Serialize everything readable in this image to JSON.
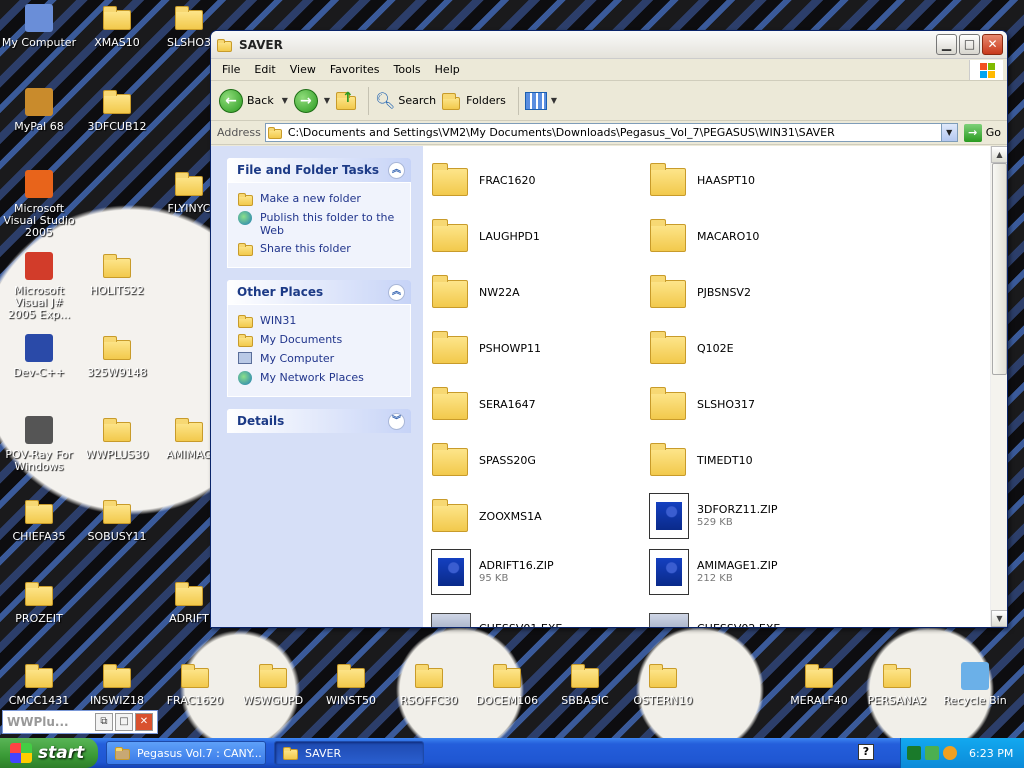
{
  "desktop": {
    "icons": [
      {
        "label": "My Computer",
        "kind": "system",
        "color": "#6a8ed8"
      },
      {
        "label": "XMAS10",
        "kind": "folder"
      },
      {
        "label": "SLSHO3",
        "kind": "folder"
      },
      {
        "label": "MyPal 68",
        "kind": "system",
        "color": "#c98b2c"
      },
      {
        "label": "3DFCUB12",
        "kind": "folder"
      },
      {
        "label": "Microsoft Visual Studio 2005",
        "kind": "system",
        "color": "#e8641b"
      },
      {
        "label": "FLYINYC",
        "kind": "folder"
      },
      {
        "label": "Microsoft Visual J# 2005 Exp...",
        "kind": "system",
        "color": "#d23c2a"
      },
      {
        "label": "HOLITS22",
        "kind": "folder"
      },
      {
        "label": "Dev-C++",
        "kind": "system",
        "color": "#2a4aa8"
      },
      {
        "label": "325W9148",
        "kind": "folder"
      },
      {
        "label": "POV-Ray For Windows",
        "kind": "system",
        "color": "#555555"
      },
      {
        "label": "WWPLUS30",
        "kind": "folder"
      },
      {
        "label": "AMIMAG",
        "kind": "folder"
      },
      {
        "label": "CHIEFA35",
        "kind": "folder"
      },
      {
        "label": "SOBUSY11",
        "kind": "folder"
      },
      {
        "label": "PROZEIT",
        "kind": "folder"
      },
      {
        "label": "ADRIFT",
        "kind": "folder"
      },
      {
        "label": "CMCC1431",
        "kind": "folder"
      },
      {
        "label": "INSWIZ18",
        "kind": "folder"
      },
      {
        "label": "FRAC1620",
        "kind": "folder"
      },
      {
        "label": "WSWGUPD",
        "kind": "folder"
      },
      {
        "label": "WINST50",
        "kind": "folder"
      },
      {
        "label": "RSOFFC30",
        "kind": "folder"
      },
      {
        "label": "DOCEM106",
        "kind": "folder"
      },
      {
        "label": "SBBASIC",
        "kind": "folder"
      },
      {
        "label": "OSTERN10",
        "kind": "folder"
      },
      {
        "label": "MERALF40",
        "kind": "folder"
      },
      {
        "label": "PERSANA2",
        "kind": "folder"
      },
      {
        "label": "Recycle Bin",
        "kind": "system",
        "color": "#6bb0e8"
      }
    ]
  },
  "window": {
    "title": "SAVER",
    "buttons": {
      "minimize": "▁",
      "maximize": "□",
      "close": "✕"
    },
    "menu": [
      "File",
      "Edit",
      "View",
      "Favorites",
      "Tools",
      "Help"
    ],
    "toolbar": {
      "back": "Back",
      "search": "Search",
      "folders": "Folders"
    },
    "address": {
      "label": "Address",
      "path": "C:\\Documents and Settings\\VM2\\My Documents\\Downloads\\Pegasus_Vol_7\\PEGASUS\\WIN31\\SAVER",
      "go": "Go"
    },
    "tasks": {
      "title": "File and Folder Tasks",
      "items": [
        "Make a new folder",
        "Publish this folder to the Web",
        "Share this folder"
      ]
    },
    "other_places": {
      "title": "Other Places",
      "items": [
        "WIN31",
        "My Documents",
        "My Computer",
        "My Network Places"
      ]
    },
    "details": {
      "title": "Details"
    },
    "files": [
      {
        "name": "FRAC1620",
        "type": "folder"
      },
      {
        "name": "HAASPT10",
        "type": "folder"
      },
      {
        "name": "LAUGHPD1",
        "type": "folder"
      },
      {
        "name": "MACARO10",
        "type": "folder"
      },
      {
        "name": "NW22A",
        "type": "folder"
      },
      {
        "name": "PJBSNSV2",
        "type": "folder"
      },
      {
        "name": "PSHOWP11",
        "type": "folder"
      },
      {
        "name": "Q102E",
        "type": "folder"
      },
      {
        "name": "SERA1647",
        "type": "folder"
      },
      {
        "name": "SLSHO317",
        "type": "folder"
      },
      {
        "name": "SPASS20G",
        "type": "folder"
      },
      {
        "name": "TIMEDT10",
        "type": "folder"
      },
      {
        "name": "ZOOXMS1A",
        "type": "folder"
      },
      {
        "name": "3DFORZ11.ZIP",
        "type": "zip",
        "size": "529 KB"
      },
      {
        "name": "ADRIFT16.ZIP",
        "type": "zip",
        "size": "95 KB"
      },
      {
        "name": "AMIMAGE1.ZIP",
        "type": "zip",
        "size": "212 KB"
      },
      {
        "name": "CHESSV01.EXE",
        "type": "exe"
      },
      {
        "name": "CHESSV02.EXE",
        "type": "exe"
      }
    ]
  },
  "mini_window": {
    "title": "WWPlu..."
  },
  "taskbar": {
    "start": "start",
    "buttons": [
      "Pegasus Vol.7 : CANY...",
      "SAVER"
    ],
    "clock": "6:23 PM"
  }
}
